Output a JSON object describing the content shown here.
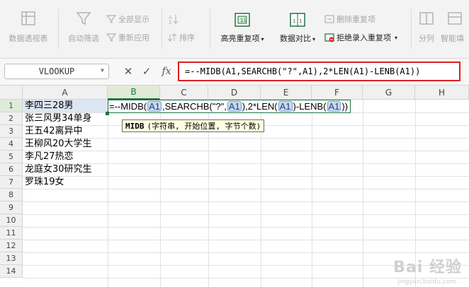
{
  "ribbon": {
    "pivot_table": "数据透视表",
    "auto_filter": "自动筛选",
    "show_all": "全部显示",
    "reapply": "重新应用",
    "sort": "排序",
    "highlight_dup": "高亮重复项",
    "data_compare": "数据对比",
    "remove_dup": "删除重复项",
    "reject_dup": "拒绝录入重复项",
    "split": "分列",
    "smart_tool": "智能填"
  },
  "formula_bar": {
    "name_box": "VLOOKUP",
    "formula": "=--MIDB(A1,SEARCHB(\"?\",A1),2*LEN(A1)-LENB(A1))"
  },
  "editing": {
    "p1": "=--MIDB(",
    "p2": ",SEARCHB(\"?\",",
    "p3": "),2*LEN(",
    "p4": ")-LENB(",
    "p5": "))",
    "ref": "A1"
  },
  "tooltip": {
    "func": "MIDB",
    "args": "(字符串, 开始位置, 字节个数)"
  },
  "columns": [
    "A",
    "B",
    "C",
    "D",
    "E",
    "F",
    "G",
    "H"
  ],
  "rows": [
    "1",
    "2",
    "3",
    "4",
    "5",
    "6",
    "7",
    "8",
    "9",
    "10",
    "11",
    "12",
    "13",
    "14"
  ],
  "cells_a": [
    "李四三28男",
    "张三风男34单身",
    "王五42离异中",
    "王柳风20大学生",
    "李凡27热恋",
    "龙庭女30研究生",
    "罗珠19女"
  ],
  "watermark": {
    "text": "Bai 经验",
    "sub": "jingyan.baidu.com"
  },
  "colors": {
    "accent_green": "#217346",
    "highlight_red": "#e02020",
    "ref_blue": "#c9daf1"
  }
}
